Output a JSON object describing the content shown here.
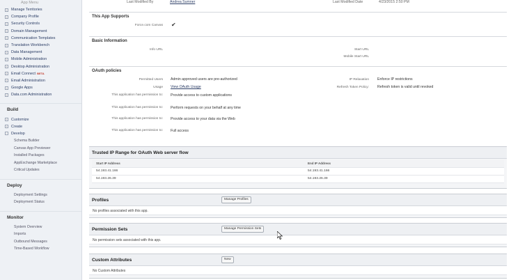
{
  "sidebar": {
    "top": "App Menu",
    "items": [
      {
        "label": "Manage Territories"
      },
      {
        "label": "Company Profile"
      },
      {
        "label": "Security Controls"
      },
      {
        "label": "Domain Management"
      },
      {
        "label": "Communication Templates"
      },
      {
        "label": "Translation Workbench"
      },
      {
        "label": "Data Management"
      },
      {
        "label": "Mobile Administration"
      },
      {
        "label": "Desktop Administration"
      },
      {
        "label": "Email Connect",
        "beta": "BETA"
      },
      {
        "label": "Email Administration"
      },
      {
        "label": "Google Apps"
      },
      {
        "label": "Data.com Administration"
      }
    ],
    "build_heading": "Build",
    "build_items": [
      {
        "label": "Customize"
      },
      {
        "label": "Create"
      },
      {
        "label": "Develop"
      }
    ],
    "develop_sub": [
      "Schema Builder",
      "Canvas App Previewer",
      "Installed Packages",
      "AppExchange Marketplace",
      "Critical Updates"
    ],
    "deploy_heading": "Deploy",
    "deploy_sub": [
      "Deployment Settings",
      "Deployment Status"
    ],
    "monitor_heading": "Monitor",
    "monitor_sub": [
      "System Overview",
      "Imports",
      "Outbound Messages",
      "Time-Based Workflow"
    ]
  },
  "topline": {
    "last_modified_by_label": "Last Modified By",
    "last_modified_by": "Andrea Sumner",
    "last_modified_date_label": "Last Modified Date",
    "last_modified_date": "4/23/2015 2:50 PM"
  },
  "app_supports": {
    "title": "This App Supports",
    "canvas_label": "Force.com Canvas",
    "canvas_check": "✔"
  },
  "basic_info": {
    "title": "Basic Information",
    "info_url": "Info URL",
    "start_url": "Start URL",
    "mobile_start_url": "Mobile Start URL"
  },
  "oauth": {
    "title": "OAuth policies",
    "permitted_users_label": "Permitted Users",
    "permitted_users": "Admin approved users are pre-authorized",
    "ip_relaxation_label": "IP Relaxation",
    "ip_relaxation": "Enforce IP restrictions",
    "usage_label": "Usage",
    "usage": "View OAuth Usage",
    "refresh_label": "Refresh Token Policy:",
    "refresh": "Refresh token is valid until revoked",
    "perm_label": "This application has permission to:",
    "perms": [
      "Provide access to custom applications",
      "Perform requests on your behalf at any time",
      "Provide access to your data via the Web",
      "Full access"
    ]
  },
  "trusted_ip": {
    "title": "Trusted IP Range for OAuth Web server flow",
    "start_header": "Start IP Address",
    "end_header": "End IP Address",
    "rows": [
      {
        "start": "54.193.41.166",
        "end": "54.193.41.166"
      },
      {
        "start": "54.193.26.39",
        "end": "54.193.26.39"
      }
    ]
  },
  "profiles": {
    "title": "Profiles",
    "button": "Manage Profiles",
    "empty": "No profiles associated with this app."
  },
  "permission_sets": {
    "title": "Permission Sets",
    "button": "Manage Permission Sets",
    "empty": "No permission sets associated with this app."
  },
  "custom_attributes": {
    "title": "Custom Attributes",
    "button": "New",
    "empty": "No Custom Attributes"
  }
}
